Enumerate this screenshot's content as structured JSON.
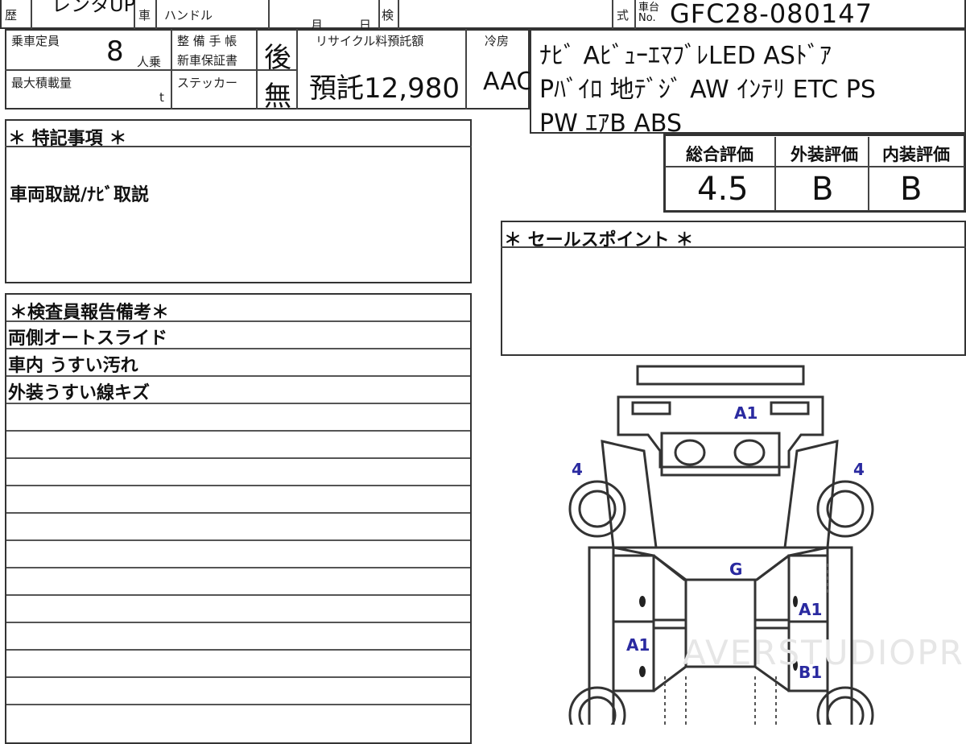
{
  "header": {
    "reki_label": "歴",
    "reki_value": "レンタUP",
    "sha_label": "車",
    "handle_label": "ハンドル",
    "month_label": "月",
    "day_label": "日",
    "ken_label": "検",
    "shiki_label": "式",
    "chassis_label_1": "車台",
    "chassis_label_2": "No.",
    "chassis_number": "GFC28-080147"
  },
  "specs": {
    "capacity_label": "乗車定員",
    "capacity_value": "8",
    "capacity_unit": "人乗",
    "maintenance_label_1": "整 備 手 帳",
    "maintenance_label_2": "新車保証書",
    "maintenance_value": "後",
    "sticker_label": "ステッカー",
    "sticker_value": "無",
    "max_load_label": "最大積載量",
    "max_load_unit": "t",
    "recycle_label": "リサイクル料預託額",
    "recycle_value": "預託12,980",
    "aircon_label": "冷房",
    "aircon_value": "AAC"
  },
  "equipment": {
    "line1": "ﾅﾋﾞ AﾋﾞｭｰｴﾏﾌﾞﾚLED ASﾄﾞｱ",
    "line2": "Pﾊﾞｲﾛ 地ﾃﾞｼﾞ AW ｲﾝﾃﾘ ETC PS",
    "line3": "PW ｴｱB ABS"
  },
  "grades": {
    "overall_label": "総合評価",
    "overall_value": "4.5",
    "exterior_label": "外装評価",
    "exterior_value": "B",
    "interior_label": "内装評価",
    "interior_value": "B"
  },
  "special_notes": {
    "title": "＊ 特記事項 ＊",
    "body": "車両取説/ﾅﾋﾞ取説"
  },
  "sales_points": {
    "title": "＊ セールスポイント ＊"
  },
  "inspector_notes": {
    "title": "＊検査員報告備考＊",
    "lines": [
      "両側オートスライド",
      "車内 うすい汚れ",
      "外装うすい線キズ"
    ]
  },
  "diagram_marks": {
    "front_center": "A1",
    "left_front_tire": "4",
    "right_front_tire": "4",
    "roof": "G",
    "right_door": "A1",
    "left_door": "A1",
    "right_slide": "B1"
  },
  "watermark": "AVERSTUDIOPRO",
  "colors": {
    "mark": "#2a2aa0",
    "line": "#333333"
  }
}
